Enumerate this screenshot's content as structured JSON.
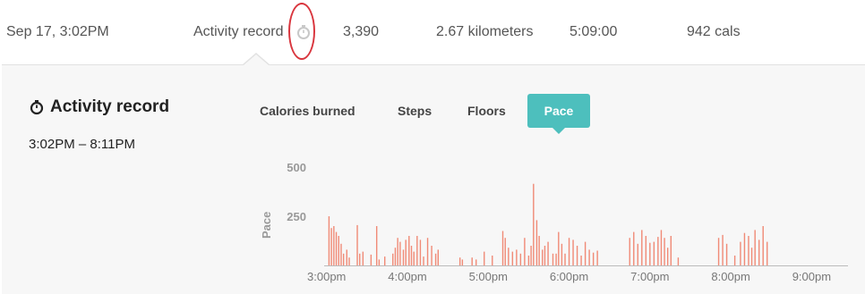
{
  "record_row": {
    "date": "Sep 17, 3:02PM",
    "type": "Activity record",
    "steps": "3,390",
    "distance": "2.67 kilometers",
    "duration": "5:09:00",
    "calories": "942 cals"
  },
  "panel": {
    "title": "Activity record",
    "time_range": "3:02PM – 8:11PM"
  },
  "tabs": [
    {
      "label": "Calories burned",
      "active": false
    },
    {
      "label": "Steps",
      "active": false
    },
    {
      "label": "Floors",
      "active": false
    },
    {
      "label": "Pace",
      "active": true
    }
  ],
  "colors": {
    "accent": "#4dbfbd",
    "bar": "#f08a76",
    "highlight": "#d9363e"
  },
  "chart_data": {
    "type": "bar",
    "ylabel": "Pace",
    "yticks": [
      "500",
      "250"
    ],
    "ylim": [
      0,
      500
    ],
    "xticks": [
      "3:00pm",
      "4:00pm",
      "5:00pm",
      "6:00pm",
      "7:00pm",
      "8:00pm",
      "9:00pm"
    ],
    "x_hours": [
      3,
      4,
      5,
      6,
      7,
      8,
      9
    ],
    "xlim_hours": [
      2.97,
      9.45
    ],
    "points": [
      [
        3.03,
        250
      ],
      [
        3.06,
        190
      ],
      [
        3.09,
        200
      ],
      [
        3.12,
        170
      ],
      [
        3.15,
        150
      ],
      [
        3.18,
        110
      ],
      [
        3.21,
        60
      ],
      [
        3.25,
        80
      ],
      [
        3.28,
        40
      ],
      [
        3.38,
        205
      ],
      [
        3.41,
        60
      ],
      [
        3.45,
        70
      ],
      [
        3.55,
        55
      ],
      [
        3.62,
        200
      ],
      [
        3.65,
        30
      ],
      [
        3.72,
        45
      ],
      [
        3.82,
        60
      ],
      [
        3.85,
        90
      ],
      [
        3.88,
        140
      ],
      [
        3.91,
        120
      ],
      [
        3.95,
        80
      ],
      [
        3.98,
        130
      ],
      [
        4.02,
        150
      ],
      [
        4.05,
        100
      ],
      [
        4.08,
        70
      ],
      [
        4.12,
        150
      ],
      [
        4.16,
        130
      ],
      [
        4.2,
        45
      ],
      [
        4.25,
        140
      ],
      [
        4.3,
        100
      ],
      [
        4.35,
        60
      ],
      [
        4.38,
        80
      ],
      [
        4.65,
        40
      ],
      [
        4.68,
        30
      ],
      [
        4.8,
        40
      ],
      [
        4.85,
        30
      ],
      [
        4.95,
        70
      ],
      [
        5.05,
        50
      ],
      [
        5.18,
        175
      ],
      [
        5.21,
        140
      ],
      [
        5.25,
        90
      ],
      [
        5.3,
        70
      ],
      [
        5.35,
        80
      ],
      [
        5.4,
        60
      ],
      [
        5.45,
        140
      ],
      [
        5.5,
        50
      ],
      [
        5.53,
        100
      ],
      [
        5.56,
        415
      ],
      [
        5.6,
        230
      ],
      [
        5.63,
        150
      ],
      [
        5.67,
        80
      ],
      [
        5.7,
        100
      ],
      [
        5.74,
        120
      ],
      [
        5.8,
        60
      ],
      [
        5.84,
        60
      ],
      [
        5.87,
        170
      ],
      [
        5.91,
        110
      ],
      [
        5.95,
        60
      ],
      [
        6.0,
        140
      ],
      [
        6.05,
        130
      ],
      [
        6.1,
        100
      ],
      [
        6.15,
        50
      ],
      [
        6.2,
        120
      ],
      [
        6.25,
        80
      ],
      [
        6.3,
        65
      ],
      [
        6.35,
        75
      ],
      [
        6.75,
        140
      ],
      [
        6.8,
        170
      ],
      [
        6.85,
        110
      ],
      [
        6.9,
        180
      ],
      [
        6.95,
        150
      ],
      [
        7.0,
        115
      ],
      [
        7.05,
        120
      ],
      [
        7.1,
        145
      ],
      [
        7.14,
        180
      ],
      [
        7.18,
        140
      ],
      [
        7.22,
        90
      ],
      [
        7.26,
        150
      ],
      [
        7.35,
        40
      ],
      [
        7.85,
        140
      ],
      [
        7.9,
        155
      ],
      [
        7.95,
        110
      ],
      [
        8.05,
        50
      ],
      [
        8.12,
        120
      ],
      [
        8.17,
        165
      ],
      [
        8.22,
        150
      ],
      [
        8.26,
        90
      ],
      [
        8.3,
        180
      ],
      [
        8.35,
        130
      ],
      [
        8.4,
        200
      ],
      [
        8.45,
        120
      ]
    ]
  }
}
